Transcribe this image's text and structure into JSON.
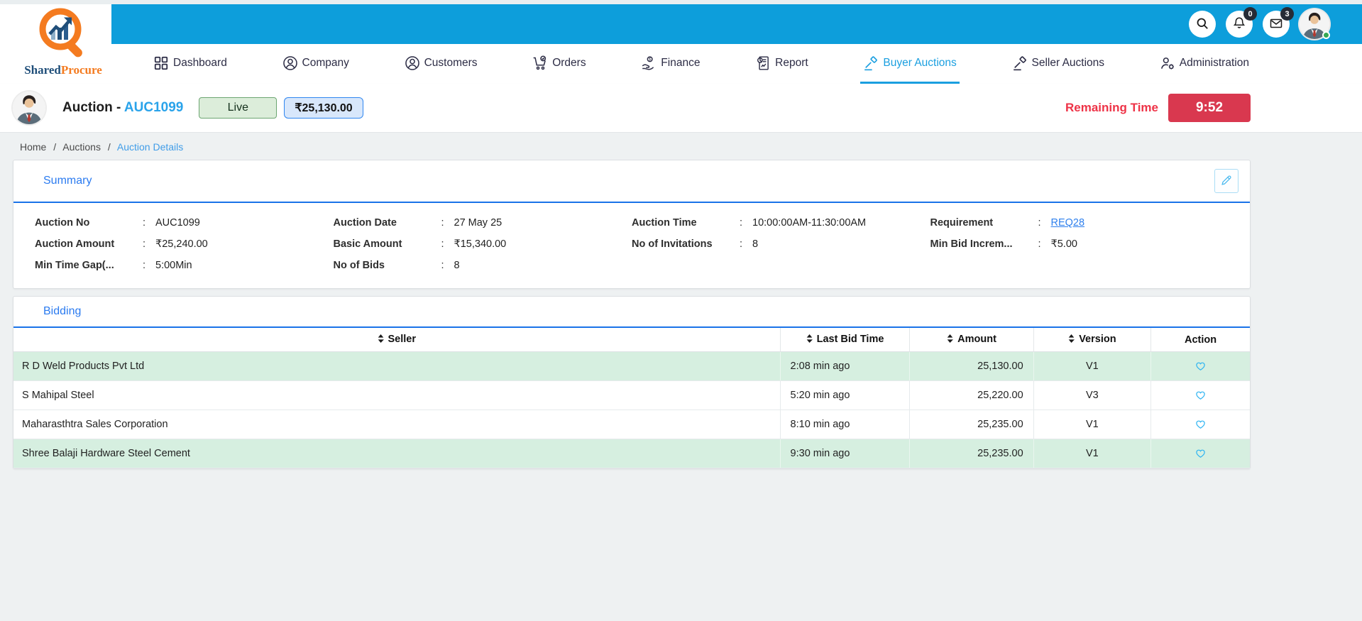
{
  "brand": {
    "name_part1": "Shared",
    "name_part2": "Procure"
  },
  "topbar": {
    "notification_count": "0",
    "message_count": "3"
  },
  "nav": {
    "items": [
      {
        "label": "Dashboard",
        "icon": "dashboard-grid-icon",
        "active": false
      },
      {
        "label": "Company",
        "icon": "person-circle-icon",
        "active": false
      },
      {
        "label": "Customers",
        "icon": "person-circle-icon",
        "active": false
      },
      {
        "label": "Orders",
        "icon": "cart-check-icon",
        "active": false
      },
      {
        "label": "Finance",
        "icon": "hand-coin-icon",
        "active": false
      },
      {
        "label": "Report",
        "icon": "report-doc-icon",
        "active": false
      },
      {
        "label": "Buyer Auctions",
        "icon": "gavel-icon",
        "active": true
      },
      {
        "label": "Seller Auctions",
        "icon": "gavel-icon",
        "active": false
      },
      {
        "label": "Administration",
        "icon": "person-gear-icon",
        "active": false
      }
    ]
  },
  "auction_header": {
    "title": "Auction -",
    "auction_no": "AUC1099",
    "status_badge": "Live",
    "amount_badge": "₹25,130.00",
    "remaining_time_label": "Remaining Time",
    "remaining_time_value": "9:52"
  },
  "breadcrumb": {
    "items": [
      "Home",
      "Auctions",
      "Auction Details"
    ],
    "separator": "/"
  },
  "summary": {
    "title": "Summary",
    "fields": [
      {
        "label": "Auction No",
        "value": "AUC1099"
      },
      {
        "label": "Auction Date",
        "value": "27 May 25"
      },
      {
        "label": "Auction Time",
        "value": "10:00:00AM-11:30:00AM"
      },
      {
        "label": "Requirement",
        "value": "REQ28",
        "link": true
      },
      {
        "label": "Auction Amount",
        "value": "₹25,240.00"
      },
      {
        "label": "Basic Amount",
        "value": "₹15,340.00"
      },
      {
        "label": "No of Invitations",
        "value": "8"
      },
      {
        "label": "Min Bid Increm...",
        "value": "₹5.00"
      },
      {
        "label": "Min Time Gap(...",
        "value": "5:00Min"
      },
      {
        "label": "No of Bids",
        "value": "8"
      }
    ]
  },
  "bidding": {
    "title": "Bidding",
    "columns": [
      {
        "label": "Seller",
        "sortable": true
      },
      {
        "label": "Last Bid Time",
        "sortable": true
      },
      {
        "label": "Amount",
        "sortable": true
      },
      {
        "label": "Version",
        "sortable": true
      },
      {
        "label": "Action",
        "sortable": false
      }
    ],
    "rows": [
      {
        "seller": "R D Weld Products Pvt Ltd",
        "last_bid_time": "2:08 min ago",
        "amount": "25,130.00",
        "version": "V1",
        "highlighted": true
      },
      {
        "seller": "S Mahipal Steel",
        "last_bid_time": "5:20 min ago",
        "amount": "25,220.00",
        "version": "V3",
        "highlighted": false
      },
      {
        "seller": "Maharasthtra Sales Corporation",
        "last_bid_time": "8:10 min ago",
        "amount": "25,235.00",
        "version": "V1",
        "highlighted": false
      },
      {
        "seller": "Shree Balaji Hardware Steel Cement",
        "last_bid_time": "9:30 min ago",
        "amount": "25,235.00",
        "version": "V1",
        "highlighted": true
      }
    ]
  },
  "colors": {
    "topbar_blue": "#0d9edb",
    "active_nav_blue": "#1a9fe0",
    "section_title_blue": "#2b7bf0",
    "divider_blue": "#1a73e8",
    "live_badge_bg": "#dcedda",
    "amount_badge_bg": "#d8e7fb",
    "remaining_red": "#ee3347",
    "timer_badge_bg": "#d9384f",
    "row_highlight_green": "#d6efe0",
    "heart_blue": "#2bb3f2",
    "link_blue": "#2f80ed"
  }
}
